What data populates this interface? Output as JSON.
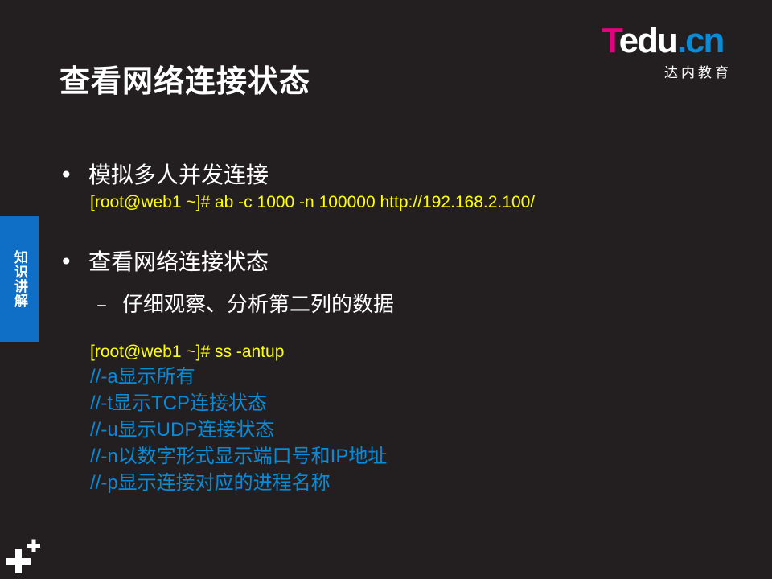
{
  "slide": {
    "title": "查看网络连接状态",
    "logo": {
      "t": "T",
      "rest": "edu",
      "cn": ".cn",
      "sub": "达内教育"
    },
    "side_tab": "知识讲解",
    "bullet1": {
      "marker": "•",
      "text": "模拟多人并发连接",
      "command": "[root@web1 ~]# ab -c 1000 -n 100000 http://192.168.2.100/"
    },
    "bullet2": {
      "marker": "•",
      "text": "查看网络连接状态",
      "sub_marker": "–",
      "sub_text": "仔细观察、分析第二列的数据",
      "command": "[root@web1 ~]# ss -antup",
      "comments": [
        "//-a显示所有",
        "//-t显示TCP连接状态",
        "//-u显示UDP连接状态",
        "//-n以数字形式显示端口号和IP地址",
        "//-p显示连接对应的进程名称"
      ]
    },
    "colors": {
      "background": "#231f20",
      "command": "#ffff00",
      "comment": "#0a8bd6",
      "tab": "#0f6fc6",
      "logo_pink": "#e4007f"
    },
    "corner_icon": "plus-icon"
  }
}
